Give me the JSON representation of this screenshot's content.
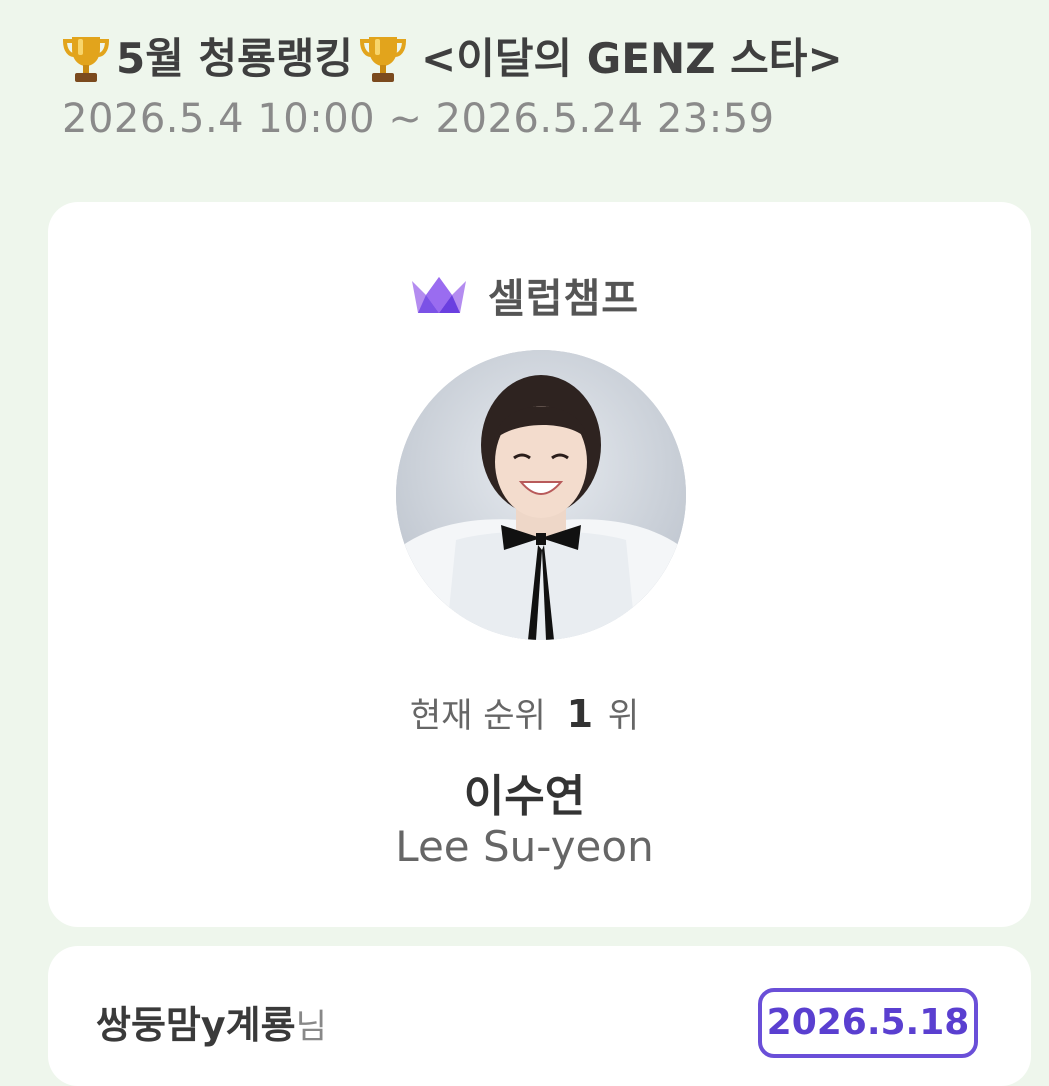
{
  "header": {
    "title_part1": "5월 청룡랭킹",
    "title_part2": "<이달의 GENZ 스타>",
    "period": "2026.5.4 10:00 ~ 2026.5.24 23:59"
  },
  "brand": {
    "name": "셀럽챔프",
    "icon": "crown-icon",
    "colors": {
      "crown_light": "#b48cf0",
      "crown_dark": "#6a3fe0"
    }
  },
  "profile": {
    "rank_label": "현재 순위",
    "rank_number": "1",
    "rank_unit": "위",
    "name_ko": "이수연",
    "name_en": "Lee Su-yeon"
  },
  "entry": {
    "username": "쌍둥맘y계룡",
    "suffix": "님",
    "date": "2026.5.18"
  },
  "colors": {
    "background": "#eef6ec",
    "accent": "#6a4fd8"
  }
}
